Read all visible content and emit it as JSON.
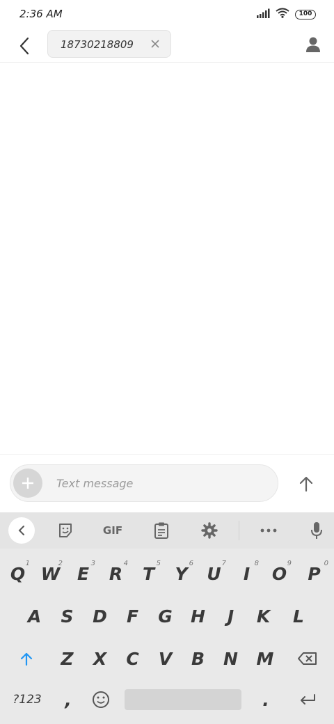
{
  "status_bar": {
    "time": "2:36 AM",
    "battery": "100",
    "icons": [
      "signal-icon",
      "wifi-icon",
      "battery-icon"
    ]
  },
  "header": {
    "recipient": "18730218809",
    "icons": [
      "back-arrow-icon",
      "close-icon",
      "person-icon"
    ]
  },
  "compose": {
    "placeholder": "Text message",
    "value": "",
    "icons": [
      "plus-icon",
      "send-arrow-icon"
    ]
  },
  "keyboard": {
    "toolbar": {
      "gif_label": "GIF",
      "icons": [
        "chevron-left-icon",
        "sticker-icon",
        "clipboard-icon",
        "gear-icon",
        "more-dots-icon",
        "microphone-icon"
      ]
    },
    "row1": [
      "Q",
      "W",
      "E",
      "R",
      "T",
      "Y",
      "U",
      "I",
      "O",
      "P"
    ],
    "row1_hints": [
      "1",
      "2",
      "3",
      "4",
      "5",
      "6",
      "7",
      "8",
      "9",
      "0"
    ],
    "row2": [
      "A",
      "S",
      "D",
      "F",
      "G",
      "H",
      "J",
      "K",
      "L"
    ],
    "row3": [
      "Z",
      "X",
      "C",
      "V",
      "B",
      "N",
      "M"
    ],
    "bottom": {
      "symbols": "?123",
      "comma": ",",
      "period": ".",
      "icons": [
        "shift-icon",
        "backspace-icon",
        "emoji-icon",
        "enter-icon"
      ]
    },
    "colors": {
      "shift_accent": "#2196f3",
      "background": "#e9e9e9"
    }
  }
}
